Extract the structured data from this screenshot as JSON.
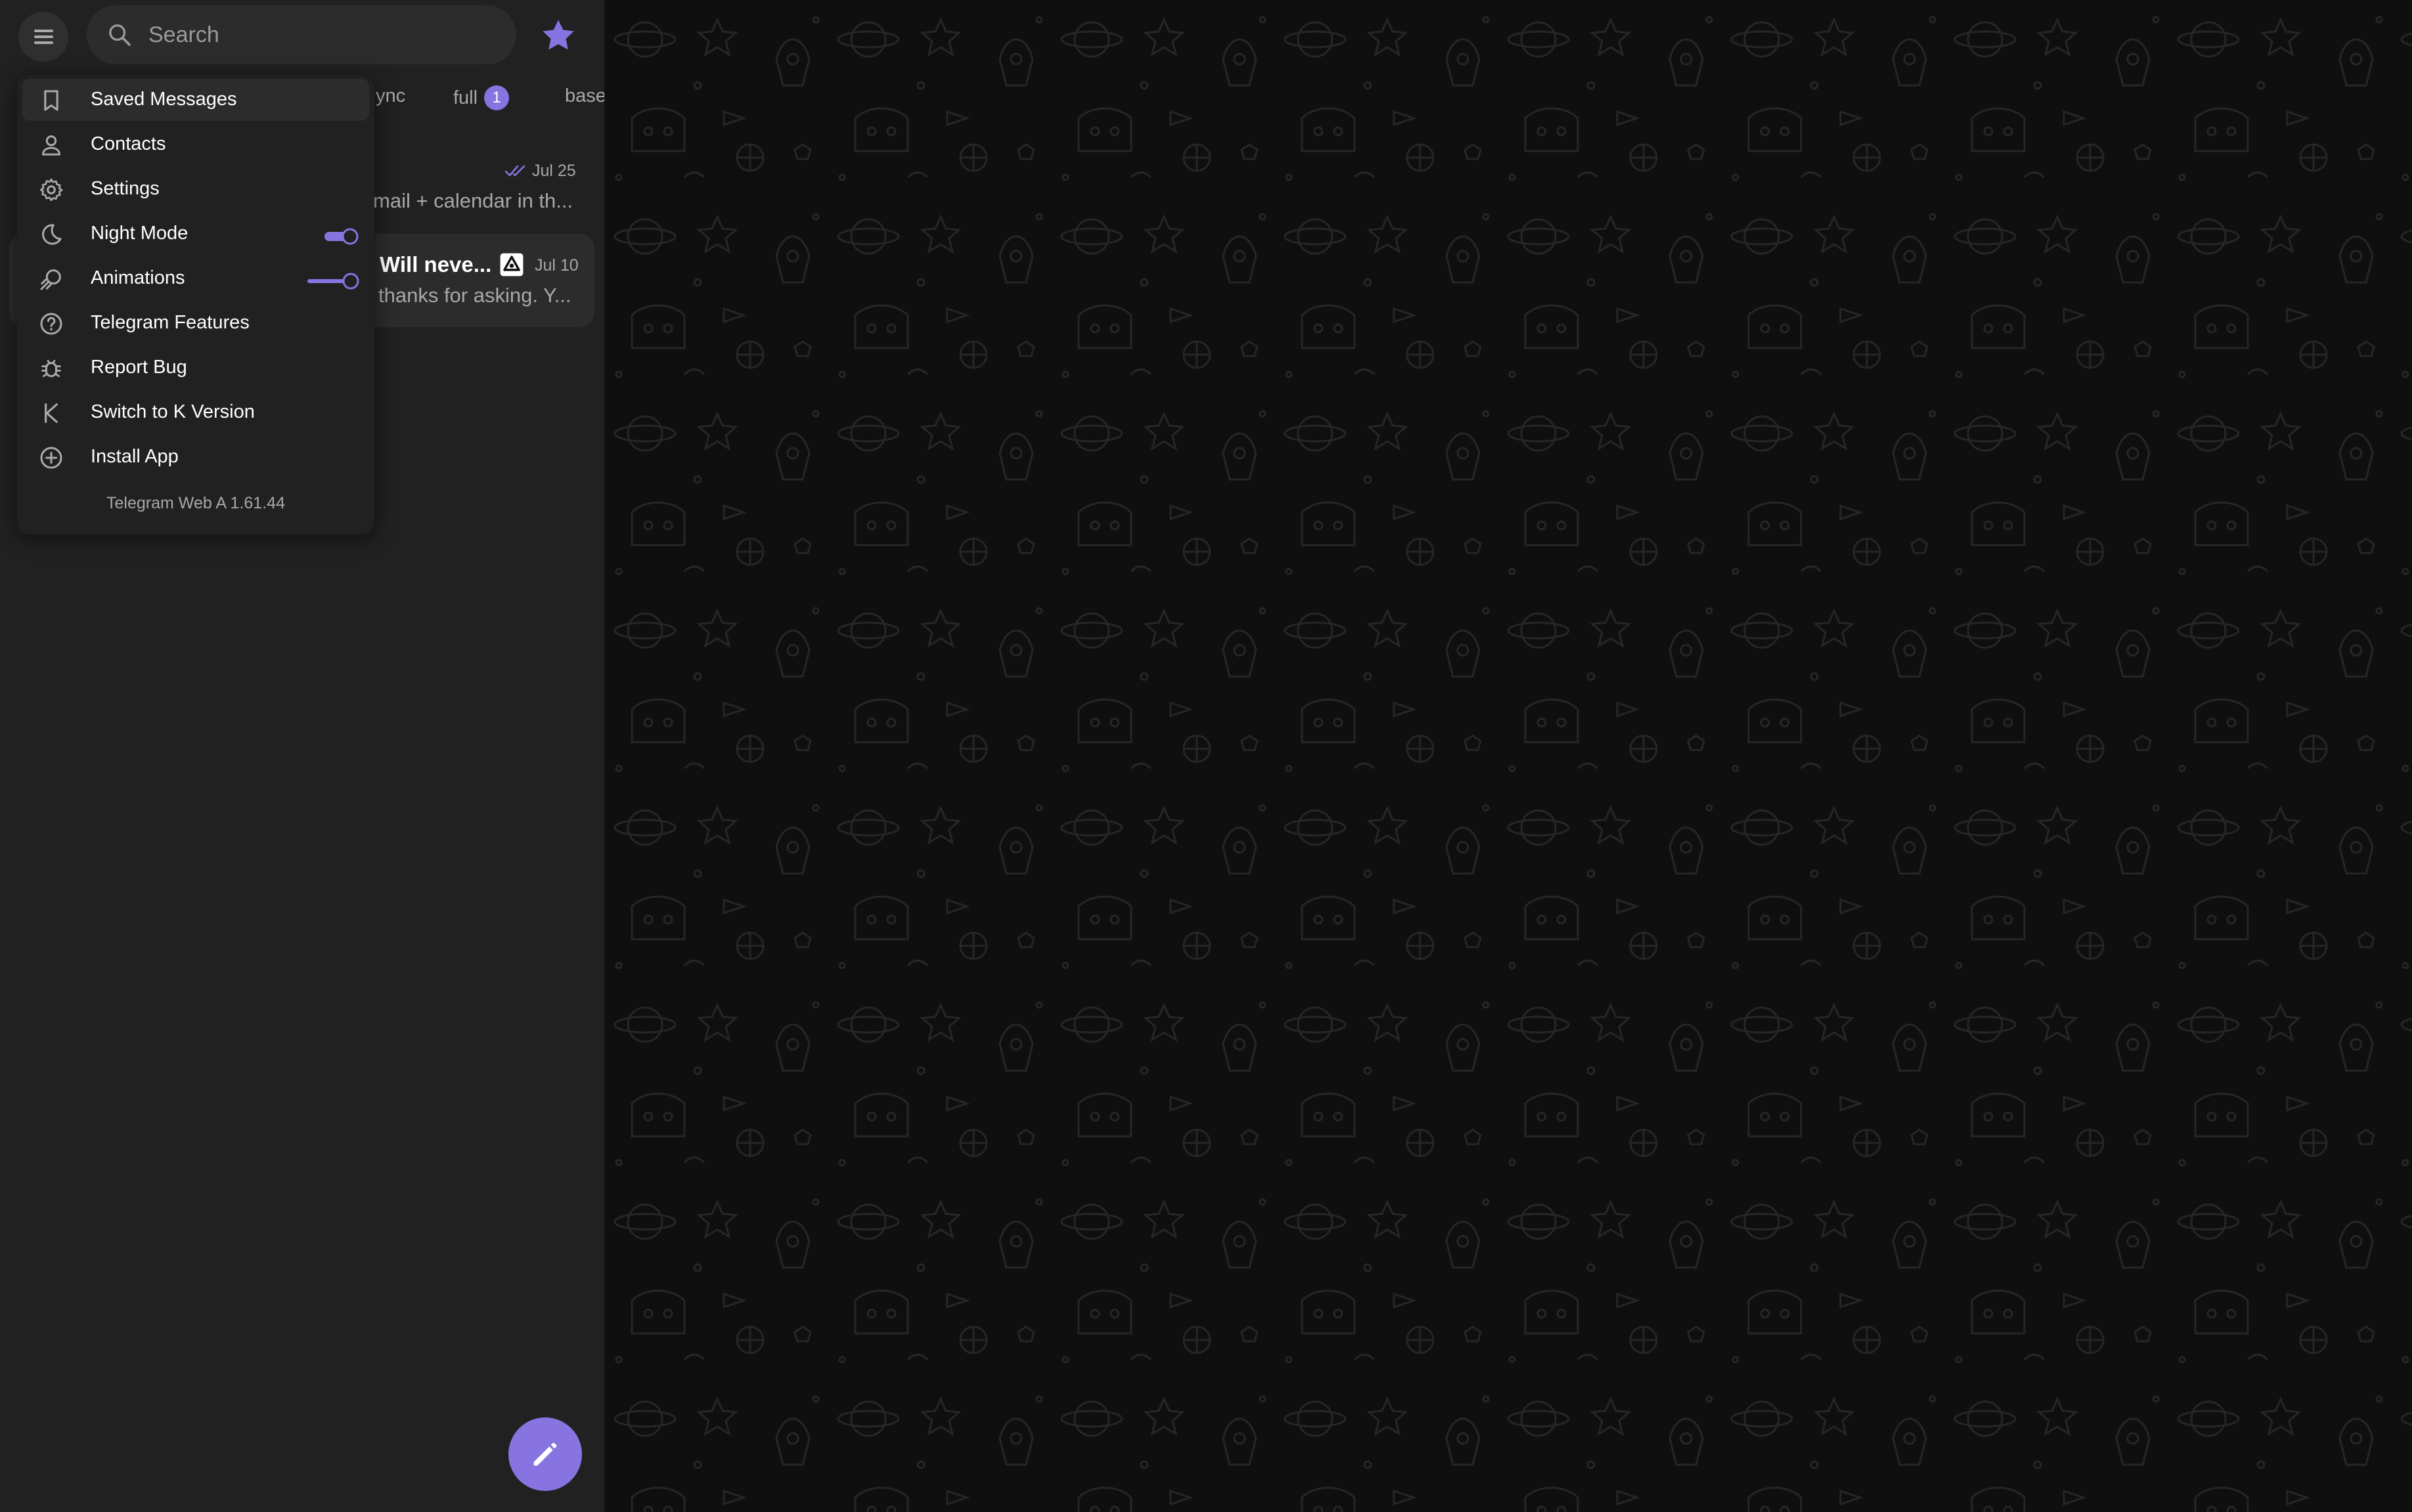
{
  "search": {
    "placeholder": "Search"
  },
  "folders": [
    {
      "label": "ync",
      "badge": ""
    },
    {
      "label": "full",
      "badge": "1"
    },
    {
      "label": "base",
      "badge": ""
    }
  ],
  "chats": [
    {
      "title": "",
      "preview": "mail + calendar in th...",
      "date": "Jul 25"
    },
    {
      "title": "Will neve...",
      "preview": "thanks for asking. Y...",
      "date": "Jul 10"
    }
  ],
  "menu": {
    "items": [
      {
        "label": "Saved Messages",
        "icon": "bookmark-icon"
      },
      {
        "label": "Contacts",
        "icon": "person-icon"
      },
      {
        "label": "Settings",
        "icon": "gear-icon"
      },
      {
        "label": "Night Mode",
        "icon": "moon-icon",
        "toggle": "on"
      },
      {
        "label": "Animations",
        "icon": "animations-icon",
        "toggle": "on"
      },
      {
        "label": "Telegram Features",
        "icon": "help-icon"
      },
      {
        "label": "Report Bug",
        "icon": "bug-icon"
      },
      {
        "label": "Switch to K Version",
        "icon": "k-letter-icon"
      },
      {
        "label": "Install App",
        "icon": "plus-circle-icon"
      }
    ],
    "version": "Telegram Web A 1.61.44"
  },
  "colors": {
    "accent": "#8774e1",
    "panel": "#212121",
    "background": "#0f0f0f"
  }
}
